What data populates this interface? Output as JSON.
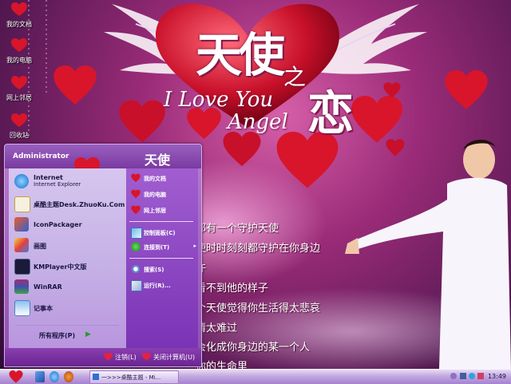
{
  "desktop_icons": [
    {
      "label": "我的文档",
      "icon": "folder-heart-icon"
    },
    {
      "label": "我的电脑",
      "icon": "computer-heart-icon"
    },
    {
      "label": "网上邻居",
      "icon": "network-heart-icon"
    },
    {
      "label": "回收站",
      "icon": "recycle-bin-heart-icon"
    }
  ],
  "wallpaper": {
    "title_cn_1": "天使",
    "title_cn_zhi": "之",
    "title_cn_2": "恋",
    "title_en_1": "I Love You",
    "title_en_2": "Angel",
    "lyrics": [
      "都有一个守护天使",
      "使时时刻刻都守护在你身边",
      "许",
      "看不到他的样子",
      "个天使觉得你生活得太悲哀",
      "情太难过",
      "会化成你身边的某一个人",
      "你的生命里"
    ]
  },
  "start_menu": {
    "user": "Administrator",
    "left_items": [
      {
        "title": "Internet",
        "subtitle": "Internet Explorer",
        "icon": "ie-icon"
      },
      {
        "title": "桌酷主题Desk.ZhuoKu.Com",
        "subtitle": "",
        "icon": "zhuoku-icon"
      },
      {
        "title": "IconPackager",
        "subtitle": "",
        "icon": "iconpackager-icon"
      },
      {
        "title": "画图",
        "subtitle": "",
        "icon": "paint-icon"
      },
      {
        "title": "KMPlayer中文版",
        "subtitle": "",
        "icon": "kmplayer-icon"
      },
      {
        "title": "WinRAR",
        "subtitle": "",
        "icon": "winrar-icon"
      },
      {
        "title": "记事本",
        "subtitle": "",
        "icon": "notepad-icon"
      }
    ],
    "all_programs": "所有程序(P)",
    "right_items": [
      {
        "label": "我的文档",
        "icon": "heart-icon",
        "arrow": ""
      },
      {
        "label": "我的电脑",
        "icon": "heart-icon",
        "arrow": ""
      },
      {
        "label": "网上邻居",
        "icon": "heart-icon",
        "arrow": ""
      },
      {
        "label": "控制面板(C)",
        "icon": "control-panel-icon",
        "arrow": ""
      },
      {
        "label": "连接到(T)",
        "icon": "connect-icon",
        "arrow": "▸"
      },
      {
        "label": "搜索(S)",
        "icon": "search-icon",
        "arrow": ""
      },
      {
        "label": "运行(R)...",
        "icon": "run-icon",
        "arrow": ""
      }
    ],
    "logoff": "注销(L)",
    "shutdown": "关闭计算机(U)"
  },
  "taskbar": {
    "task_label": "一>>>桌酷主题 - Mi...",
    "clock": "13:49"
  },
  "colors": {
    "heart": "#d8152b",
    "menu_left": "#d6c6ef",
    "menu_right": "#8e44c4",
    "taskbar": "#c2a8e0"
  }
}
